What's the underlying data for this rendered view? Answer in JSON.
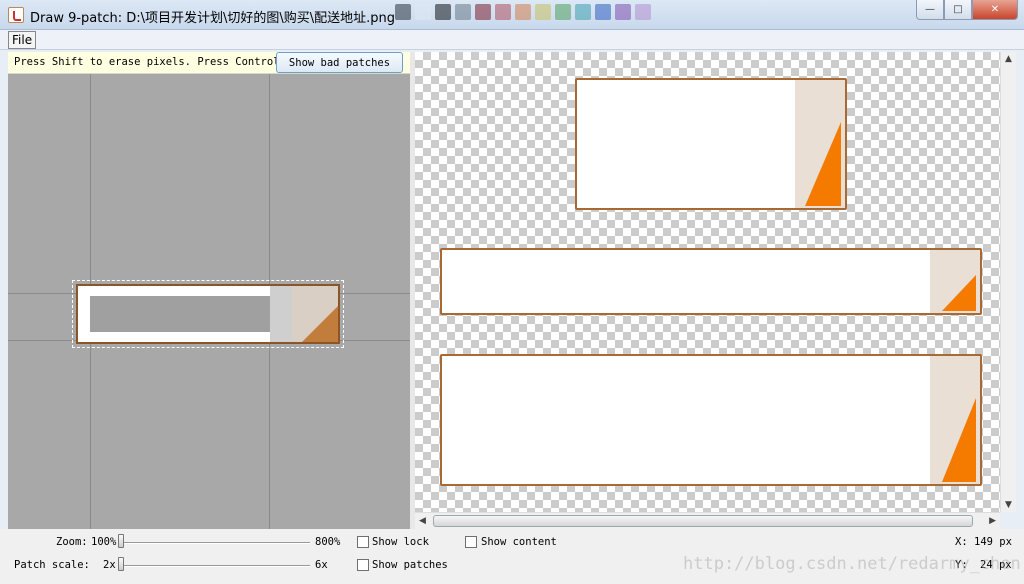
{
  "window": {
    "title": "Draw 9-patch: D:\\项目开发计划\\切好的图\\购买\\配送地址.png",
    "minimize": "—",
    "maximize": "□",
    "close": "✕"
  },
  "menu": {
    "file": "File"
  },
  "editor": {
    "hint": "Press Shift to erase pixels. Press Control to",
    "bad_patches_button": "Show bad patches"
  },
  "controls": {
    "zoom_label": "Zoom:",
    "zoom_min": "100%",
    "zoom_max": "800%",
    "zoom_value": 0.0,
    "patch_scale_label": "Patch scale:",
    "patch_scale_min": "2x",
    "patch_scale_max": "6x",
    "patch_scale_value": 0.0,
    "show_lock": "Show lock",
    "show_patches": "Show patches",
    "show_content": "Show content",
    "x_label": "X:",
    "x_value": "149 px",
    "y_label": "Y:",
    "y_value": "24 px"
  },
  "watermark": "http://blog.csdn.net/redarmy_chen",
  "colors": {
    "border": "#a86a34",
    "accent_orange": "#f47a00",
    "tan_panel": "#e9dfd4"
  }
}
